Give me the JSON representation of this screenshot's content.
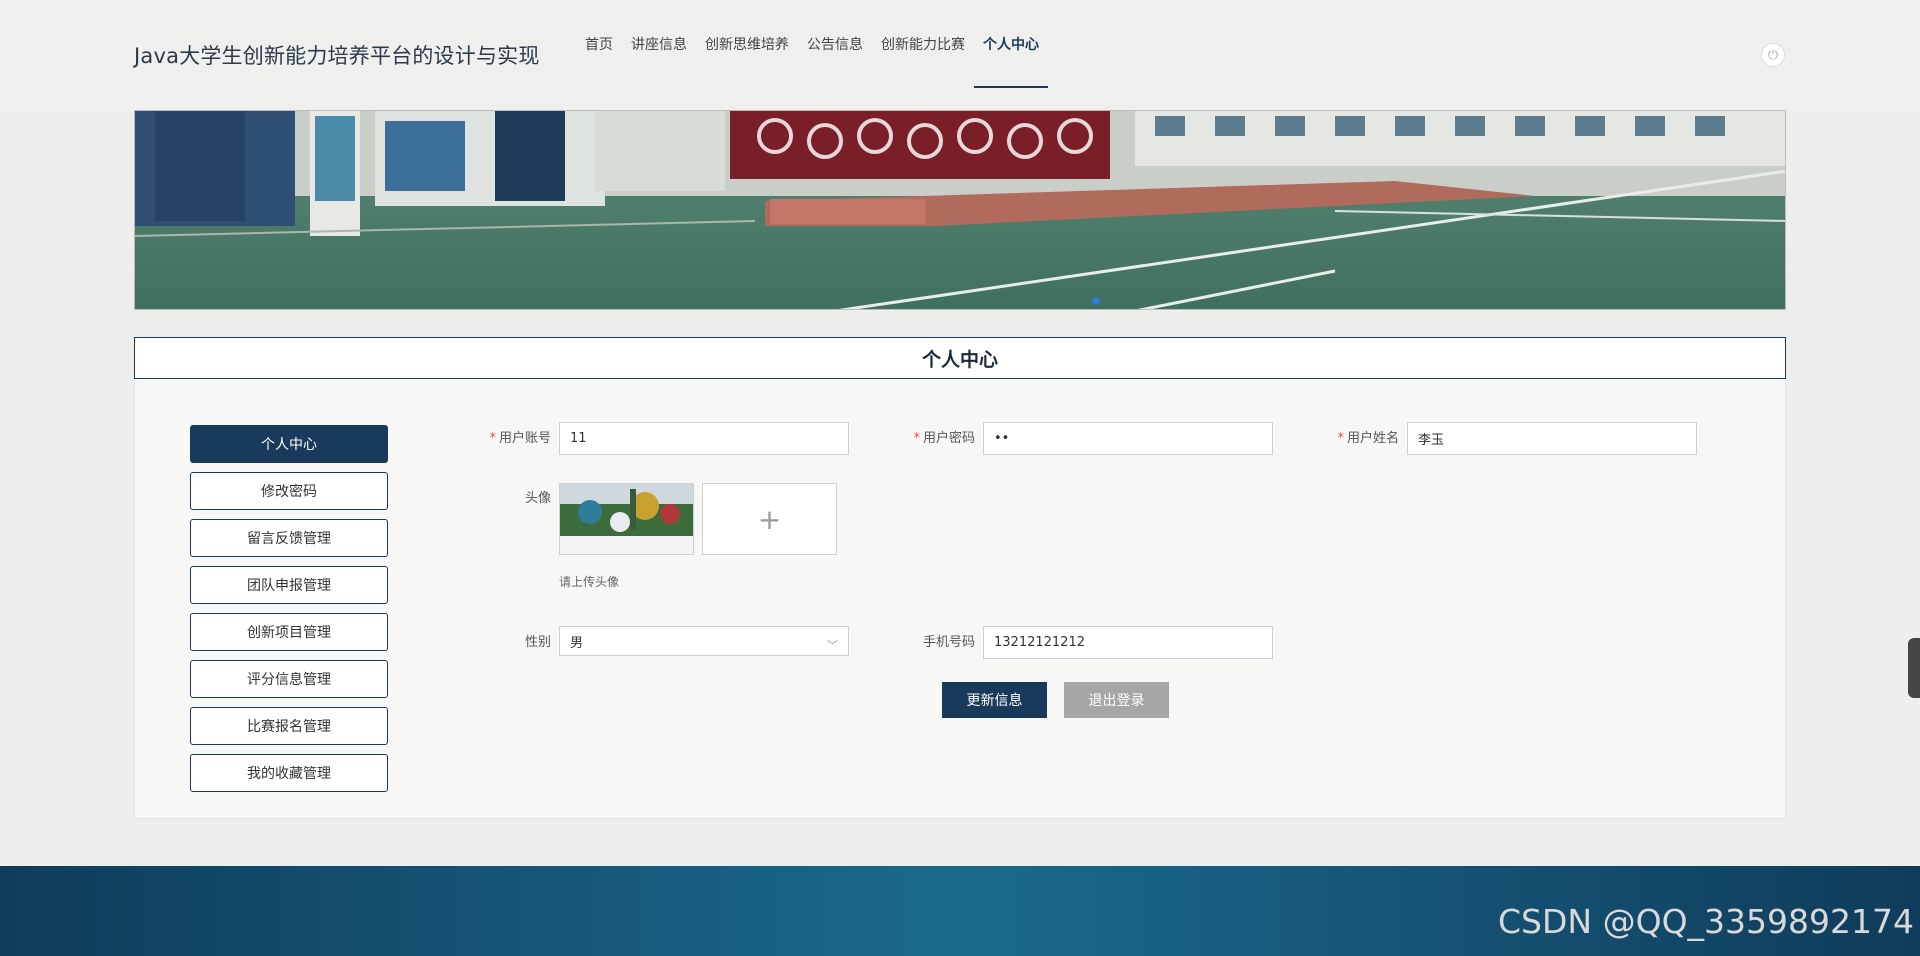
{
  "header": {
    "site_title": "Java大学生创新能力培养平台的设计与实现",
    "nav": [
      "首页",
      "讲座信息",
      "创新思维培养",
      "公告信息",
      "创新能力比赛",
      "个人中心"
    ],
    "active_nav": "个人中心"
  },
  "section": {
    "title": "个人中心"
  },
  "side_menu": [
    "个人中心",
    "修改密码",
    "留言反馈管理",
    "团队申报管理",
    "创新项目管理",
    "评分信息管理",
    "比赛报名管理",
    "我的收藏管理"
  ],
  "form": {
    "account_label": "用户账号",
    "account_value": "11",
    "password_label": "用户密码",
    "password_value": "••",
    "name_label": "用户姓名",
    "name_value": "李玉",
    "avatar_label": "头像",
    "avatar_plus": "+",
    "avatar_hint": "请上传头像",
    "gender_label": "性别",
    "gender_value": "男",
    "phone_label": "手机号码",
    "phone_value": "13212121212",
    "update_button": "更新信息",
    "logout_button": "退出登录"
  },
  "watermark": "CSDN @QQ_3359892174",
  "colors": {
    "primary": "#1a3a5c",
    "secondary_button": "#a6a6a6",
    "required": "#e05050"
  }
}
